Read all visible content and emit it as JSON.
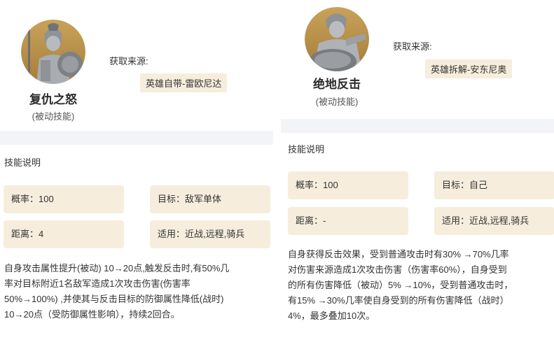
{
  "left": {
    "skill_name": "复仇之怒",
    "skill_type": "(被动技能)",
    "source_label": "获取来源:",
    "source_value": "英雄自带-雷欧尼达",
    "section_title": "技能说明",
    "stats": [
      "概率：100",
      "目标：敌军单体",
      "距离：4",
      "适用：近战,远程,骑兵"
    ],
    "description_lines": [
      "自身攻击属性提升(被动) 10→20点,触发反击时,有50%几",
      "率对目标附近1名敌军造成1次攻击伤害(伤害率",
      "50%→100%) ,并使其与反击目标的防御属性降低(战时)",
      "10→20点（受防御属性影响），持续2回合。"
    ],
    "avatar_icon": "spartan-warrior-portrait-icon"
  },
  "right": {
    "skill_name": "绝地反击",
    "skill_type": "(被动技能)",
    "source_label": "获取来源:",
    "source_value": "英雄拆解-安东尼奥",
    "section_title": "技能说明",
    "stats": [
      "概率：100",
      "目标：自己",
      "距离：-",
      "适用：近战,远程,骑兵"
    ],
    "description_lines": [
      "自身获得反击效果，受到普通攻击时有30% →70%几率",
      "对伤害来源造成1次攻击伤害（伤害率60%），自身受到",
      "的所有伤害降低（被动）5% →10%，受到普通攻击时，",
      "有15% →30%几率使自身受到的所有伤害降低（战时）",
      "4%，最多叠加10次。"
    ],
    "avatar_icon": "shield-warrior-portrait-icon"
  },
  "colors": {
    "badge_bg": "#f6eddc",
    "band_bg": "#f3f4f8",
    "avatar_gold": "#b8924a",
    "avatar_stone": "#9ea3a8"
  }
}
